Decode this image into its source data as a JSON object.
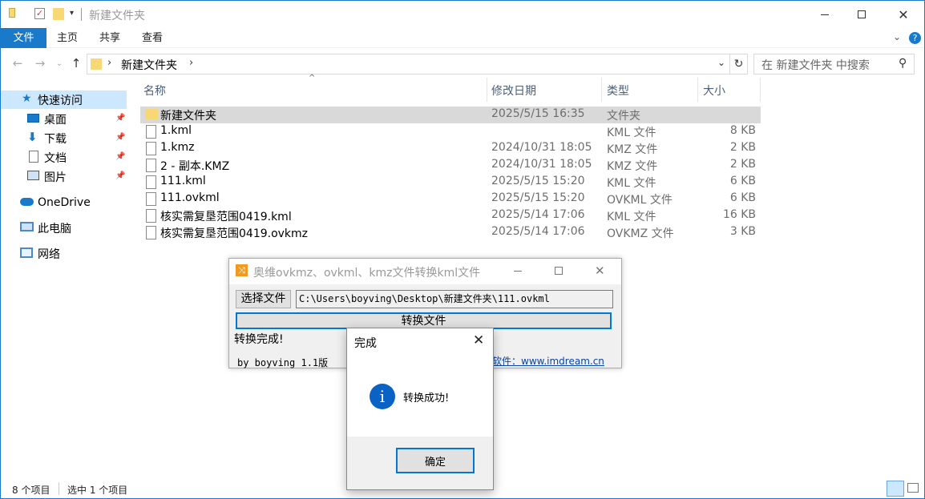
{
  "window": {
    "title": "新建文件夹"
  },
  "ribbon": {
    "tabs": [
      "文件",
      "主页",
      "共享",
      "查看"
    ]
  },
  "address": {
    "crumb": "新建文件夹",
    "search_placeholder": "在 新建文件夹 中搜索"
  },
  "sidebar": {
    "quick_access": "快速访问",
    "items": [
      {
        "label": "桌面",
        "icon": "desktop-icon"
      },
      {
        "label": "下载",
        "icon": "download-icon"
      },
      {
        "label": "文档",
        "icon": "document-icon"
      },
      {
        "label": "图片",
        "icon": "picture-icon"
      }
    ],
    "onedrive": "OneDrive",
    "this_pc": "此电脑",
    "network": "网络"
  },
  "columns": {
    "name": "名称",
    "modified": "修改日期",
    "type": "类型",
    "size": "大小"
  },
  "files": [
    {
      "name": "新建文件夹",
      "modified": "2025/5/15 16:35",
      "type": "文件夹",
      "size": "",
      "folder": true,
      "selected": true
    },
    {
      "name": "1.kml",
      "modified": "",
      "type": "KML 文件",
      "size": "8 KB"
    },
    {
      "name": "1.kmz",
      "modified": "2024/10/31 18:05",
      "type": "KMZ 文件",
      "size": "2 KB"
    },
    {
      "name": "2 - 副本.KMZ",
      "modified": "2024/10/31 18:05",
      "type": "KMZ 文件",
      "size": "2 KB"
    },
    {
      "name": "111.kml",
      "modified": "2025/5/15 15:20",
      "type": "KML 文件",
      "size": "6 KB"
    },
    {
      "name": "111.ovkml",
      "modified": "2025/5/15 15:20",
      "type": "OVKML 文件",
      "size": "6 KB"
    },
    {
      "name": "核实需复垦范围0419.kml",
      "modified": "2025/5/14 17:06",
      "type": "KML 文件",
      "size": "16 KB"
    },
    {
      "name": "核实需复垦范围0419.ovkmz",
      "modified": "2025/5/14 17:06",
      "type": "OVKMZ 文件",
      "size": "3 KB"
    }
  ],
  "status": {
    "count": "8 个项目",
    "selected": "选中 1 个项目"
  },
  "converter": {
    "title": "奥维ovkmz、ovkml、kmz文件转换kml文件",
    "choose_label": "选择文件",
    "path": "C:\\Users\\boyving\\Desktop\\新建文件夹\\111.ovkml",
    "convert_label": "转换文件",
    "result": "转换完成!",
    "version": "by boyving 1.1版",
    "link": "软件：www.imdream.cn"
  },
  "dialog": {
    "title": "完成",
    "message": "转换成功!",
    "ok_label": "确定"
  },
  "colors": {
    "accent": "#1979ca",
    "selection": "#cce8ff",
    "row_selected": "#d9d9d9"
  }
}
